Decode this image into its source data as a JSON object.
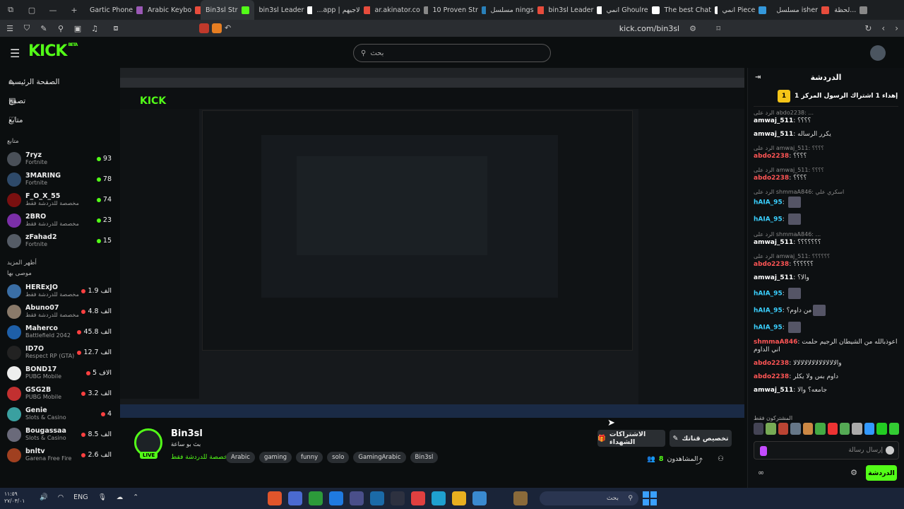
{
  "browser": {
    "tabs": [
      {
        "label": "Gartic Phone",
        "color": "#9b59b6"
      },
      {
        "label": "Arabic Keybo",
        "color": "#e74c3c"
      },
      {
        "label": "Bin3sl Str",
        "color": "#53fc18",
        "active": true
      },
      {
        "label": "bin3sl Leader",
        "color": "#ffffff"
      },
      {
        "label": "...app | لاجيهم",
        "color": "#e74c3c"
      },
      {
        "label": "ar.akinator.co",
        "color": "#888888"
      },
      {
        "label": "10 Proven Str",
        "color": "#2980b9"
      },
      {
        "label": "مسلسل nings",
        "color": "#e74c3c"
      },
      {
        "label": "bin3sl Leader",
        "color": "#ffffff"
      },
      {
        "label": "انمي Ghoulre",
        "color": "#ffffff"
      },
      {
        "label": "The best Chat",
        "color": "#ffffff"
      },
      {
        "label": "انمي Piece",
        "color": "#3498db"
      },
      {
        "label": "مسلسل isher",
        "color": "#e74c3c"
      },
      {
        "label": "لحظة...",
        "color": "#888888"
      }
    ],
    "url": "kick.com/bin3sl"
  },
  "header": {
    "logo": "KICK",
    "logo_sup": "BETA",
    "search_placeholder": "بحث"
  },
  "sidebar": {
    "menu": [
      {
        "label": "الصفحة الرئيسية",
        "icon": "home-icon",
        "glyph": "⌂"
      },
      {
        "label": "تصفح",
        "icon": "browse-icon",
        "glyph": "▤"
      },
      {
        "label": "متابع",
        "icon": "heart-icon",
        "glyph": "♡"
      }
    ],
    "following_label": "متابع",
    "following": [
      {
        "name": "7ryz",
        "cat": "Fortnite",
        "views": "93",
        "color": "#4a5058"
      },
      {
        "name": "3MARING",
        "cat": "Fortnite",
        "views": "78",
        "color": "#2e4a6a"
      },
      {
        "name": "F_O_X_55",
        "cat": "مخصصة للدردشة فقط",
        "views": "74",
        "color": "#7a1010"
      },
      {
        "name": "2BRO",
        "cat": "مخصصة للدردشة فقط",
        "views": "23",
        "color": "#7b2fa8"
      },
      {
        "name": "zFahad2",
        "cat": "Fortnite",
        "views": "15",
        "color": "#555c66"
      }
    ],
    "show_more": "أظهر المزيد",
    "recommended_label": "موصى بها",
    "recommended": [
      {
        "name": "HERExJO",
        "cat": "مخصصة للدردشة فقط",
        "views": "1.9 الف",
        "color": "#3a6ea5"
      },
      {
        "name": "Abuno07",
        "cat": "مخصصة للدردشة فقط",
        "views": "4.8 الف",
        "color": "#8a7a6a"
      },
      {
        "name": "Maherco",
        "cat": "Battlefield 2042",
        "views": "45.8 الف",
        "color": "#1e5fa8"
      },
      {
        "name": "ID7O",
        "cat": "Respect RP (GTA)",
        "views": "12.7 الف",
        "color": "#222222"
      },
      {
        "name": "BOND17",
        "cat": "PUBG Mobile",
        "views": "5 الاف",
        "color": "#eeeeee"
      },
      {
        "name": "GSG2B",
        "cat": "PUBG Mobile",
        "views": "3.2 الف",
        "color": "#c23030"
      },
      {
        "name": "Genie",
        "cat": "Slots & Casino",
        "views": "4",
        "color": "#3aa0a0"
      },
      {
        "name": "Bougassaa",
        "cat": "Slots & Casino",
        "views": "8.5 الف",
        "color": "#6a6a7a"
      },
      {
        "name": "bnltv",
        "cat": "Garena Free Fire",
        "views": "2.6 الف",
        "color": "#a04020"
      }
    ]
  },
  "stream": {
    "name": "Bin3sl",
    "subtitle": "بث بو ساعة",
    "category": "مخصصة للدردشة فقط",
    "live": "LIVE",
    "tags": [
      "Arabic",
      "gaming",
      "funny",
      "solo",
      "GamingArabic",
      "Bin3sl"
    ],
    "subscribe_label": "الاشتراكات الشهداء",
    "follow_label": "تخصيص قناتك",
    "viewers_label": "المشاهدون",
    "viewers": "8"
  },
  "chat": {
    "title": "الدردشة",
    "pinned_rank": "1",
    "pinned_text": "إهداء 1 اشتراك الرسول المركز 1",
    "messages": [
      {
        "reply": "الرد على abdo2238: ...",
        "user": "amwaj_511",
        "color": "#ffffff",
        "text": "؟؟؟؟"
      },
      {
        "reply": "",
        "user": "amwaj_511",
        "color": "#ffffff",
        "text": "يكرر الرساله"
      },
      {
        "reply": "الرد على amwaj_511: ؟؟؟؟",
        "user": "abdo2238",
        "color": "#ff5555",
        "text": "؟؟؟؟"
      },
      {
        "reply": "الرد على amwaj_511: ؟؟؟؟",
        "user": "abdo2238",
        "color": "#ff5555",
        "text": "؟؟؟؟"
      },
      {
        "reply": "الرد على shmmaA846: اسكري علي",
        "user": "hAIA_95",
        "color": "#3ad0ff",
        "text": ""
      },
      {
        "reply": "",
        "user": "hAIA_95",
        "color": "#3ad0ff",
        "text": ""
      },
      {
        "reply": "الرد على shmmaA846: ...",
        "user": "amwaj_511",
        "color": "#ffffff",
        "text": "؟؟؟؟؟؟؟"
      },
      {
        "reply": "الرد على amwaj_511: ؟؟؟؟؟؟",
        "user": "abdo2238",
        "color": "#ff5555",
        "text": "؟؟؟؟؟؟"
      },
      {
        "reply": "",
        "user": "amwaj_511",
        "color": "#ffffff",
        "text": "والا؟"
      },
      {
        "reply": "",
        "user": "hAIA_95",
        "color": "#3ad0ff",
        "text": ""
      },
      {
        "reply": "",
        "user": "hAIA_95",
        "color": "#3ad0ff",
        "text": "من داوم؟"
      },
      {
        "reply": "",
        "user": "hAIA_95",
        "color": "#3ad0ff",
        "text": ""
      },
      {
        "reply": "",
        "user": "shmmaA846",
        "color": "#ff5555",
        "text": "اعوذبالله من الشيطان الرجيم حلمت اني الداوم"
      },
      {
        "reply": "",
        "user": "abdo2238",
        "color": "#ff5555",
        "text": "والالالالالالالالالالالالا"
      },
      {
        "reply": "",
        "user": "abdo2238",
        "color": "#ff5555",
        "text": "داوم بس ولا يكلر"
      },
      {
        "reply": "",
        "user": "amwaj_511",
        "color": "#ffffff",
        "text": "جامعه؟ والا"
      }
    ],
    "emote_label": "المشتركون فقط",
    "input_placeholder": "إرسال رسالة",
    "send_label": "الدردشة"
  },
  "taskbar": {
    "time": "١١:٥٩",
    "date": "٢٧/٠٣/٠١",
    "lang": "ENG",
    "search": "بحث"
  }
}
